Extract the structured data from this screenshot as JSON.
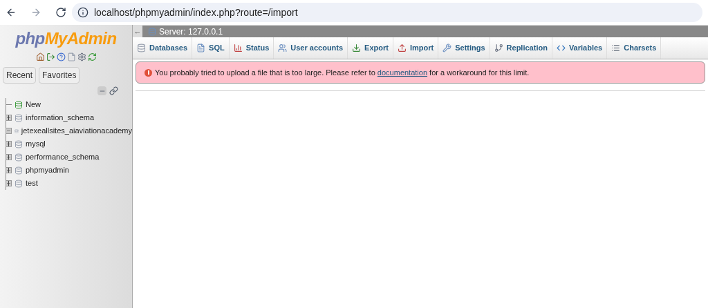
{
  "browser": {
    "url": "localhost/phpmyadmin/index.php?route=/import"
  },
  "sidebar": {
    "logo": {
      "php": "php",
      "myadmin": "MyAdmin"
    },
    "tabs": [
      {
        "label": "Recent"
      },
      {
        "label": "Favorites"
      }
    ],
    "tree": [
      {
        "kind": "new",
        "label": "New"
      },
      {
        "kind": "db",
        "label": "information_schema",
        "expanded": false
      },
      {
        "kind": "db",
        "label": "jetexeallsites_aiaviationacademy",
        "expanded": true
      },
      {
        "kind": "db",
        "label": "mysql",
        "expanded": false
      },
      {
        "kind": "db",
        "label": "performance_schema",
        "expanded": false
      },
      {
        "kind": "db",
        "label": "phpmyadmin",
        "expanded": false
      },
      {
        "kind": "db",
        "label": "test",
        "expanded": false
      }
    ]
  },
  "breadcrumb": {
    "collapse": "←",
    "server": "Server: 127.0.0.1"
  },
  "tabs": [
    {
      "label": "Databases"
    },
    {
      "label": "SQL"
    },
    {
      "label": "Status"
    },
    {
      "label": "User accounts"
    },
    {
      "label": "Export"
    },
    {
      "label": "Import"
    },
    {
      "label": "Settings"
    },
    {
      "label": "Replication"
    },
    {
      "label": "Variables"
    },
    {
      "label": "Charsets"
    }
  ],
  "error": {
    "before": "You probably tried to upload a file that is too large. Please refer to ",
    "link": "documentation",
    "after": " for a workaround for this limit."
  }
}
